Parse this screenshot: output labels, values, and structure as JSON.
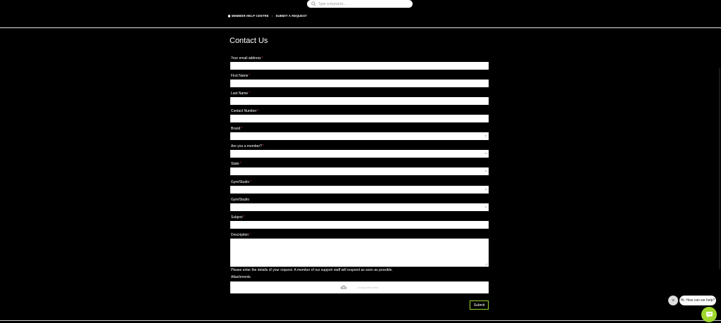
{
  "search": {
    "placeholder": "Type a keyword..."
  },
  "breadcrumb": {
    "home": "MEMBER HELP CENTRE",
    "current": "SUBMIT A REQUEST"
  },
  "page": {
    "title": "Contact Us"
  },
  "form": {
    "fields": [
      {
        "label": "Your email address",
        "required": true
      },
      {
        "label": "First Name",
        "required": true
      },
      {
        "label": "Last Name",
        "required": true
      },
      {
        "label": "Contact Number",
        "required": true
      },
      {
        "label": "Brand",
        "required": true
      },
      {
        "label": "Are you a member?",
        "required": true
      },
      {
        "label": "State",
        "required": true
      },
      {
        "label": "Gym/Studio",
        "required": true
      },
      {
        "label": "Gym/Studio",
        "required": false
      },
      {
        "label": "Subject",
        "required": true
      },
      {
        "label": "Description",
        "required": true
      }
    ],
    "required_mark": "*",
    "description_help": "Please enter the details of your request. A member of our support staff will respond as soon as possible.",
    "attachments_label": "Attachments",
    "attachments_placeholder": "or drop files here",
    "submit_label": "Submit"
  },
  "chat": {
    "close_label": "×",
    "bubble_text": "Hi. How can we help?"
  },
  "colors": {
    "accent": "#a0d62e",
    "required": "#dd3333",
    "background": "#000000"
  }
}
